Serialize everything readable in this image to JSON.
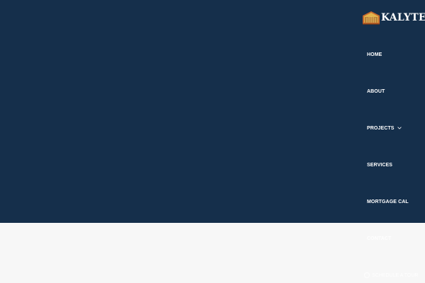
{
  "brand": {
    "name": "KALYTER",
    "logo_icon": "building-logo-icon",
    "colors": {
      "hero": "#152f4b",
      "surface": "#f7f7f7",
      "logo_gold": "#d7a43a",
      "logo_orange": "#c6682d"
    }
  },
  "nav": {
    "items": [
      {
        "label": "HOME"
      },
      {
        "label": "ABOUT"
      },
      {
        "label": "PROJECTS",
        "icon": "chevron-down-icon"
      },
      {
        "label": "SERVICES"
      },
      {
        "label": "MORTGAGE CAL"
      },
      {
        "label": "CONTACT"
      }
    ]
  },
  "footer_note": {
    "icon": "circle-icon",
    "text": "SCHEDULE A TOUR"
  }
}
